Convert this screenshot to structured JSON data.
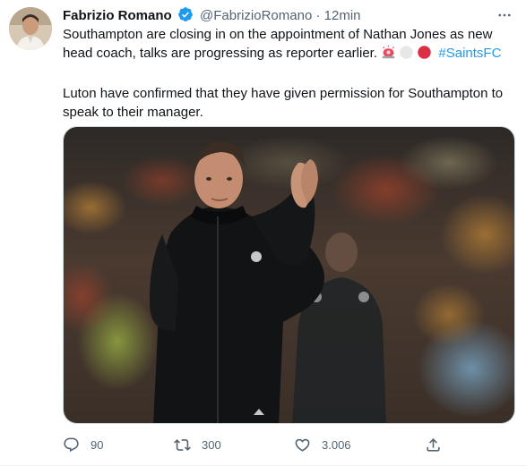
{
  "tweet": {
    "author": {
      "name": "Fabrizio Romano",
      "handle": "@FabrizioRomano",
      "separator": "·",
      "time": "12min"
    },
    "text": {
      "p1": "Southampton are closing in on the appointment of Nathan Jones as new head coach, talks are progressing as reporter earlier.",
      "hashtag": "#SaintsFC",
      "p2": "Luton have confirmed that they have given permission for Southampton to speak to their manager."
    },
    "emojis": [
      "police-light-emoji",
      "white-circle-emoji",
      "red-circle-emoji"
    ],
    "actions": {
      "replies": "90",
      "retweets": "300",
      "likes": "3.006"
    }
  },
  "colors": {
    "accent": "#1d9bf0",
    "secondary_text": "#536471",
    "primary_text": "#0f1419"
  }
}
